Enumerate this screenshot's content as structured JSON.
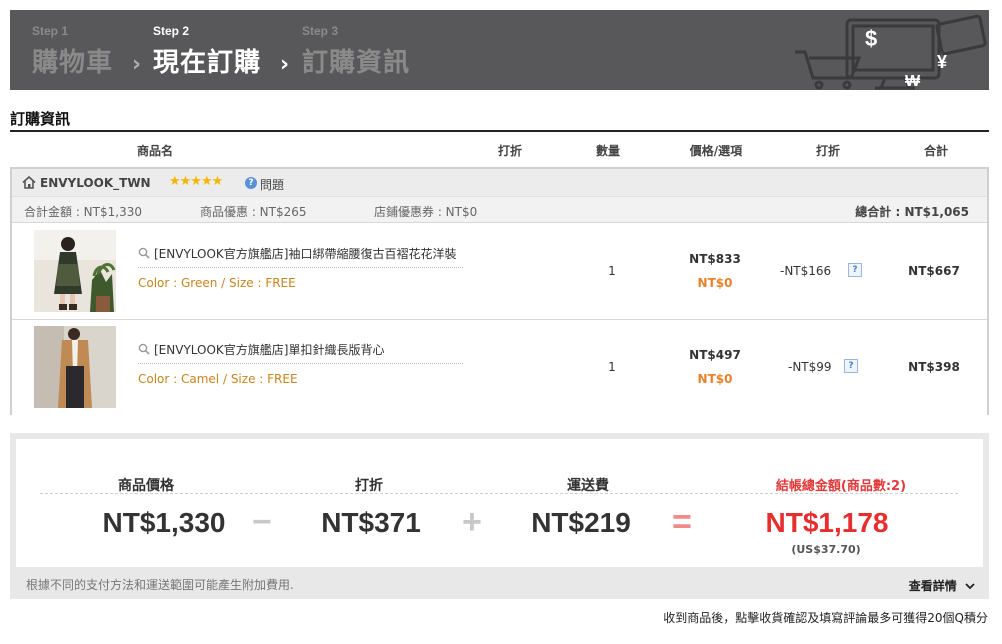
{
  "steps": [
    {
      "num": "Step 1",
      "name": "購物車"
    },
    {
      "num": "Step 2",
      "name": "現在訂購"
    },
    {
      "num": "Step 3",
      "name": "訂購資訊"
    }
  ],
  "chevron": "›",
  "section_title": "訂購資訊",
  "columns": {
    "product": "商品名",
    "discount1": "打折",
    "quantity": "數量",
    "price_option": "價格/選項",
    "discount2": "打折",
    "total": "合計"
  },
  "shop": {
    "name": "ENVYLOOK_TWN",
    "stars": "★★★★★",
    "question": "問題",
    "sum_amount": "合計金額 : NT$1,330",
    "product_discount": "商品優惠 : NT$265",
    "store_coupon": "店鋪優惠券 : NT$0",
    "grand_label": "總合計 : ",
    "grand_value": "NT$1,065"
  },
  "items": [
    {
      "title": "[ENVYLOOK官方旗艦店]袖口綁帶縮腰復古百褶花花洋裝",
      "option": "Color : Green / Size : FREE",
      "qty": "1",
      "price": "NT$833",
      "option_price": "NT$0",
      "discount": "-NT$166",
      "total": "NT$667"
    },
    {
      "title": "[ENVYLOOK官方旗艦店]單扣針織長版背心",
      "option": "Color : Camel / Size : FREE",
      "qty": "1",
      "price": "NT$497",
      "option_price": "NT$0",
      "discount": "-NT$99",
      "total": "NT$398"
    }
  ],
  "summary": {
    "product_price_label": "商品價格",
    "product_price": "NT$1,330",
    "discount_label": "打折",
    "discount": "NT$371",
    "shipping_label": "運送費",
    "shipping": "NT$219",
    "final_label": "結帳總金額(商品數:2)",
    "final": "NT$1,178",
    "final_usd": "(US$37.70)",
    "op_minus": "−",
    "op_plus": "+",
    "op_equals": "="
  },
  "footnote": "根據不同的支付方法和運送範圍可能產生附加費用.",
  "details_label": "查看詳情",
  "bottom_note": "收到商品後，點擊收貨確認及填寫評論最多可獲得20個Q積分",
  "colors": {
    "banner_bg": "#58585a",
    "accent_red": "#e62e2e",
    "option_orange": "#c8841e",
    "option_price_orange": "#e8822a",
    "star_yellow": "#f5b400"
  },
  "icons": {
    "home": "home-icon",
    "question": "question-icon",
    "magnifier": "search-icon",
    "help": "help-icon",
    "chevron_down": "chevron-down-icon",
    "deco": "cart-money-illustration"
  }
}
